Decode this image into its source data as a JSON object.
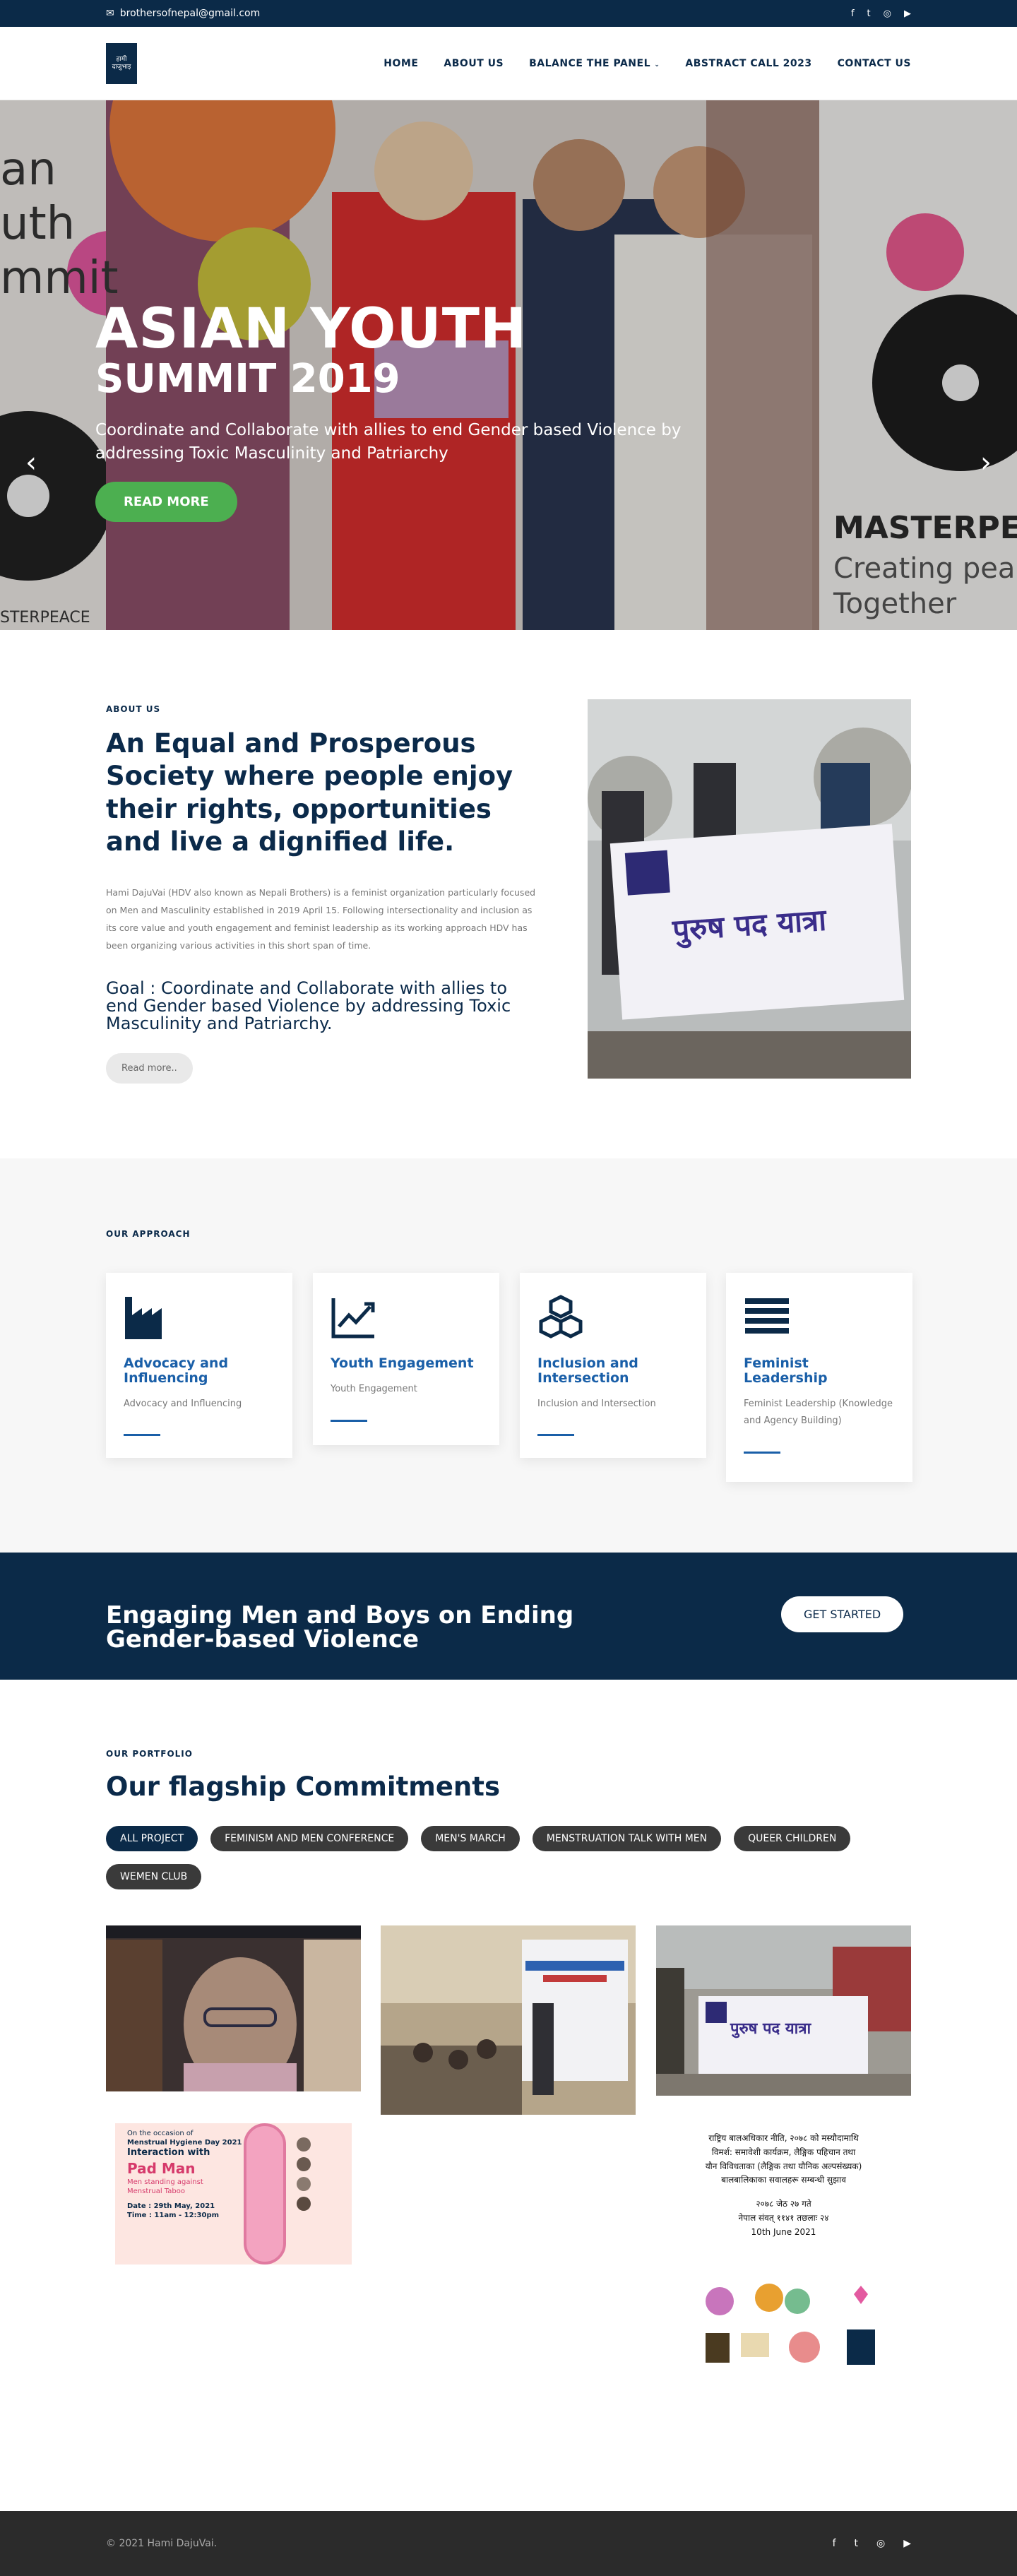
{
  "topbar": {
    "email": "brothersofnepal@gmail.com",
    "social_icons": [
      "facebook-icon",
      "twitter-icon",
      "instagram-icon",
      "youtube-icon"
    ]
  },
  "header": {
    "logo_line1": "हामी",
    "logo_line2": "दाजुभाइ",
    "nav": [
      "HOME",
      "ABOUT US",
      "BALANCE THE PANEL",
      "ABSTRACT CALL 2023",
      "CONTACT US"
    ]
  },
  "hero": {
    "title": "ASIAN YOUTH",
    "subtitle": "SUMMIT 2019",
    "text": "Coordinate and Collaborate with allies to end Gender based Violence by addressing Toxic Masculinity and Patriarchy",
    "button": "READ MORE",
    "bg_text_left": "an\nuth\nmmit",
    "bg_text_right_1": "MASTERPE",
    "bg_text_right_2": "Creating pea",
    "bg_text_right_3": "Together",
    "bg_text_left_bottom": "STERPEACE"
  },
  "about": {
    "label": "ABOUT US",
    "heading": "An Equal and Prosperous Society where people enjoy their rights, opportunities and live a dignified life.",
    "description": "Hami DajuVai (HDV also known as Nepali Brothers) is a feminist organization particularly focused on Men and Masculinity established in 2019 April 15. Following intersectionality and inclusion as its core value and youth engagement and feminist leadership as its working approach HDV has been organizing various activities in this short span of time.",
    "goal": "Goal : Coordinate and Collaborate with allies to end Gender based Violence by addressing Toxic Masculinity and Patriarchy.",
    "read_more": "Read more..",
    "banner_text": "पुरुष पद यात्रा"
  },
  "approach": {
    "label": "OUR APPROACH",
    "cards": [
      {
        "title": "Advocacy and Influencing",
        "text": "Advocacy and Influencing",
        "icon": "factory-icon"
      },
      {
        "title": "Youth Engagement",
        "text": "Youth Engagement",
        "icon": "chart-line-icon"
      },
      {
        "title": "Inclusion and Intersection",
        "text": "Inclusion and Intersection",
        "icon": "cubes-icon"
      },
      {
        "title": "Feminist Leadership",
        "text": "Feminist Leadership (Knowledge and Agency Building)",
        "icon": "bars-icon"
      }
    ]
  },
  "banner": {
    "heading": "Engaging Men and Boys on Ending Gender-based Violence",
    "button": "GET STARTED"
  },
  "portfolio": {
    "label": "OUR PORTFOLIO",
    "heading": "Our flagship Commitments",
    "filters": [
      "ALL PROJECT",
      "FEMINISM AND MEN CONFERENCE",
      "MEN'S MARCH",
      "MENSTRUATION TALK WITH MEN",
      "QUEER CHILDREN",
      "WEMEN CLUB"
    ],
    "poster": {
      "l1": "On the occasion of",
      "l2": "Menstrual Hygiene Day 2021",
      "l3": "Interaction with",
      "l4": "Pad Man",
      "l5": "Men standing against",
      "l6": "Menstrual Taboo",
      "l7": "Date : 29th May, 2021",
      "l8": "Time : 11am - 12:30pm"
    },
    "notice": {
      "l1": "राष्ट्रिय बालअधिकार नीति, २०७८ को मस्यौदामाथि",
      "l2": "विमर्श: समावेशी कार्यक्रम, लैङ्गिक पहिचान तथा",
      "l3": "यौन विविधताका (लैङ्गिक तथा यौनिक अल्पसंख्यक)",
      "l4": "बालबालिकाका सवालहरू सम्बन्धी सुझाव",
      "l5": "२०७८ जेठ २७ गते",
      "l6": "नेपाल संवत् ११४१ तछलाः २४",
      "l7": "10th June 2021"
    }
  },
  "footer": {
    "copyright": "© 2021 Hami DajuVai."
  },
  "colors": {
    "navy": "#0b2a48",
    "accent_blue": "#1a5fa8",
    "green": "#4caf50"
  }
}
